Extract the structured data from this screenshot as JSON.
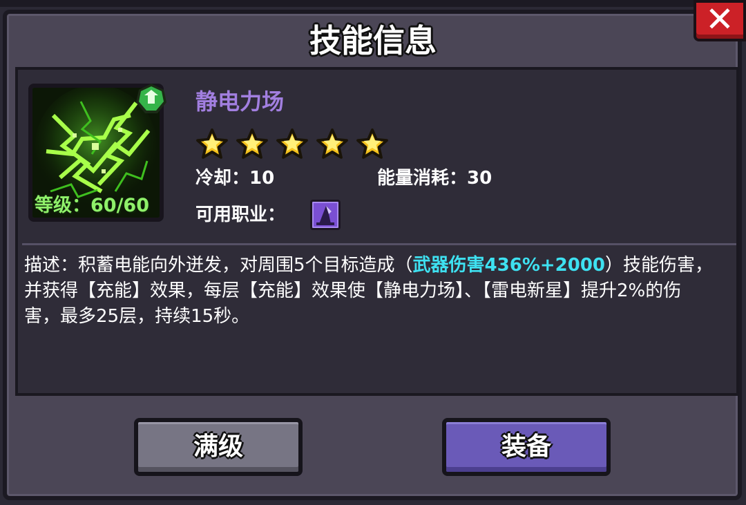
{
  "dialog": {
    "title": "技能信息",
    "close_label": "✕"
  },
  "skill": {
    "name": "静电力场",
    "icon": "static-field-lightning-icon",
    "level_text": "等级：60/60",
    "stars_filled": 5,
    "stars_total": 5,
    "cooldown_text": "冷却：10",
    "energy_text": "能量消耗：30",
    "class_label": "可用职业：",
    "class_icon": "wizard-hat-icon"
  },
  "description": {
    "prefix": "描述：积蓄电能向外迸发，对周围5个目标造成（",
    "highlight": "武器伤害436%+2000",
    "suffix": "）技能伤害，并获得【充能】效果，每层【充能】效果使【静电力场】、【雷电新星】提升2%的伤害，最多25层，持续15秒。"
  },
  "buttons": {
    "max_level": "满级",
    "equip": "装备"
  },
  "colors": {
    "panel": "#4b4656",
    "content_bg": "#2f2c38",
    "skill_name": "#a27fe0",
    "level_text": "#8ff06a",
    "highlight": "#3ee1f1",
    "close_button": "#cc2127",
    "equip_button": "#6a5ab8",
    "max_button": "#777584"
  }
}
